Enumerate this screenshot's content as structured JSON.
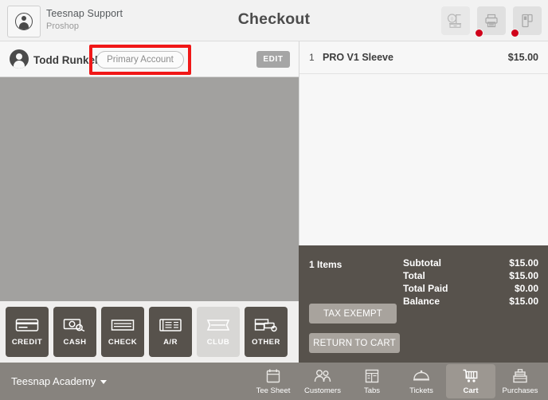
{
  "header": {
    "org_name": "Teesnap Support",
    "org_sub": "Proshop",
    "title": "Checkout",
    "user_icon": "user-avatar-icon",
    "devices": [
      {
        "name": "cash-drawer-icon",
        "status": "connected"
      },
      {
        "name": "receipt-printer-icon",
        "status": "error"
      },
      {
        "name": "card-reader-icon",
        "status": "error"
      }
    ]
  },
  "customer": {
    "name": "Todd Runkel",
    "account_label": "Primary Account",
    "edit_label": "EDIT",
    "avatar_icon": "customer-avatar-icon",
    "highlight_color": "#f01717"
  },
  "payment_methods": [
    {
      "label": "CREDIT",
      "icon": "credit-card-icon",
      "disabled": false
    },
    {
      "label": "CASH",
      "icon": "cash-bill-icon",
      "disabled": false
    },
    {
      "label": "CHECK",
      "icon": "check-icon",
      "disabled": false
    },
    {
      "label": "A/R",
      "icon": "receipt-icon",
      "disabled": false
    },
    {
      "label": "CLUB",
      "icon": "ticket-icon",
      "disabled": true
    },
    {
      "label": "OTHER",
      "icon": "other-payment-icon",
      "disabled": false
    }
  ],
  "cart": {
    "items": [
      {
        "qty": "1",
        "description": "PRO V1 Sleeve",
        "price": "$15.00"
      }
    ]
  },
  "totals": {
    "item_count": "1 Items",
    "rows": [
      {
        "label": "Subtotal",
        "value": "$15.00"
      },
      {
        "label": "Total",
        "value": "$15.00"
      },
      {
        "label": "Total Paid",
        "value": "$0.00"
      },
      {
        "label": "Balance",
        "value": "$15.00"
      }
    ],
    "tax_exempt_label": "TAX EXEMPT",
    "return_to_cart_label": "RETURN TO CART"
  },
  "bottom": {
    "academy_label": "Teesnap Academy",
    "nav": [
      {
        "label": "Tee Sheet",
        "icon": "calendar-icon",
        "active": false
      },
      {
        "label": "Customers",
        "icon": "people-icon",
        "active": false
      },
      {
        "label": "Tabs",
        "icon": "tabs-icon",
        "active": false
      },
      {
        "label": "Tickets",
        "icon": "cloche-icon",
        "active": false
      },
      {
        "label": "Cart",
        "icon": "shopping-cart-icon",
        "active": true
      },
      {
        "label": "Purchases",
        "icon": "register-icon",
        "active": false
      }
    ]
  }
}
